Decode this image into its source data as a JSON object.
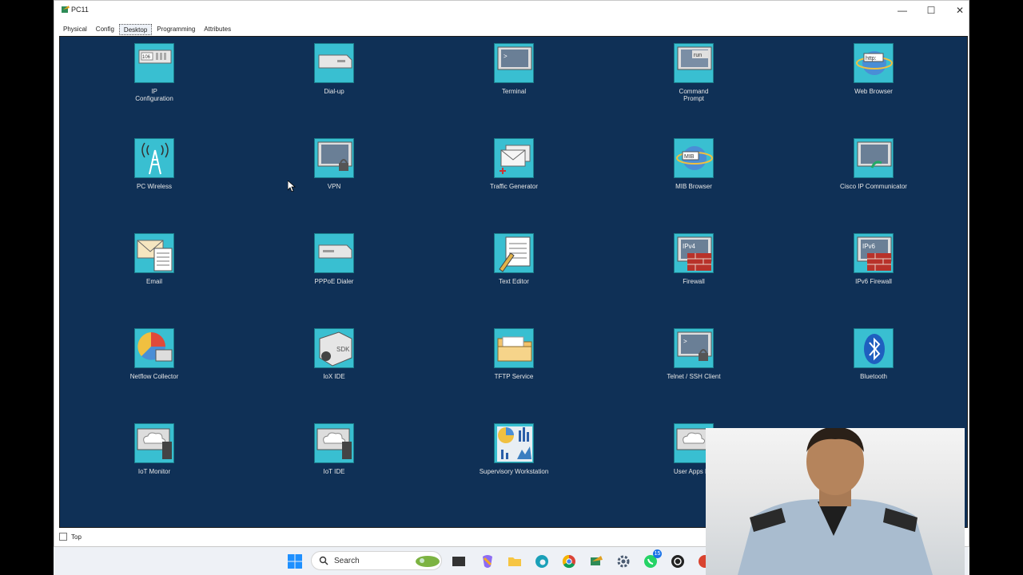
{
  "window": {
    "title": "PC11",
    "minimize": "—",
    "maximize": "☐",
    "close": "✕"
  },
  "tabs": [
    "Physical",
    "Config",
    "Desktop",
    "Programming",
    "Attributes"
  ],
  "active_tab": "Desktop",
  "apps": [
    [
      "IP",
      "Configuration"
    ],
    [
      "Dial-up"
    ],
    [
      "Terminal"
    ],
    [
      "Command",
      "Prompt"
    ],
    [
      "Web Browser"
    ],
    [
      "PC Wireless"
    ],
    [
      "VPN"
    ],
    [
      "Traffic Generator"
    ],
    [
      "MIB Browser"
    ],
    [
      "Cisco IP Communicator"
    ],
    [
      "Email"
    ],
    [
      "PPPoE Dialer"
    ],
    [
      "Text Editor"
    ],
    [
      "Firewall"
    ],
    [
      "IPv6 Firewall"
    ],
    [
      "Netflow Collector"
    ],
    [
      "IoX IDE"
    ],
    [
      "TFTP Service"
    ],
    [
      "Telnet / SSH Client"
    ],
    [
      "Bluetooth"
    ],
    [
      "IoT Monitor"
    ],
    [
      "IoT IDE"
    ],
    [
      "Supervisory Workstation"
    ],
    [
      "User Apps Ma"
    ]
  ],
  "icon_texts": {
    "ip_config": "106",
    "command_prompt": "run",
    "web_browser": "http:",
    "mib_browser": "MIB",
    "firewall": "IPv4",
    "ipv6_firewall": "IPv6",
    "iox_ide": "SDK",
    "terminal": ">",
    "telnet": ">"
  },
  "bottom": {
    "top_checkbox_label": "Top"
  },
  "taskbar": {
    "search_placeholder": "Search",
    "notification_count": "15"
  },
  "colors": {
    "desktop_bg": "#0f3056",
    "tile": "#39bfd1"
  }
}
